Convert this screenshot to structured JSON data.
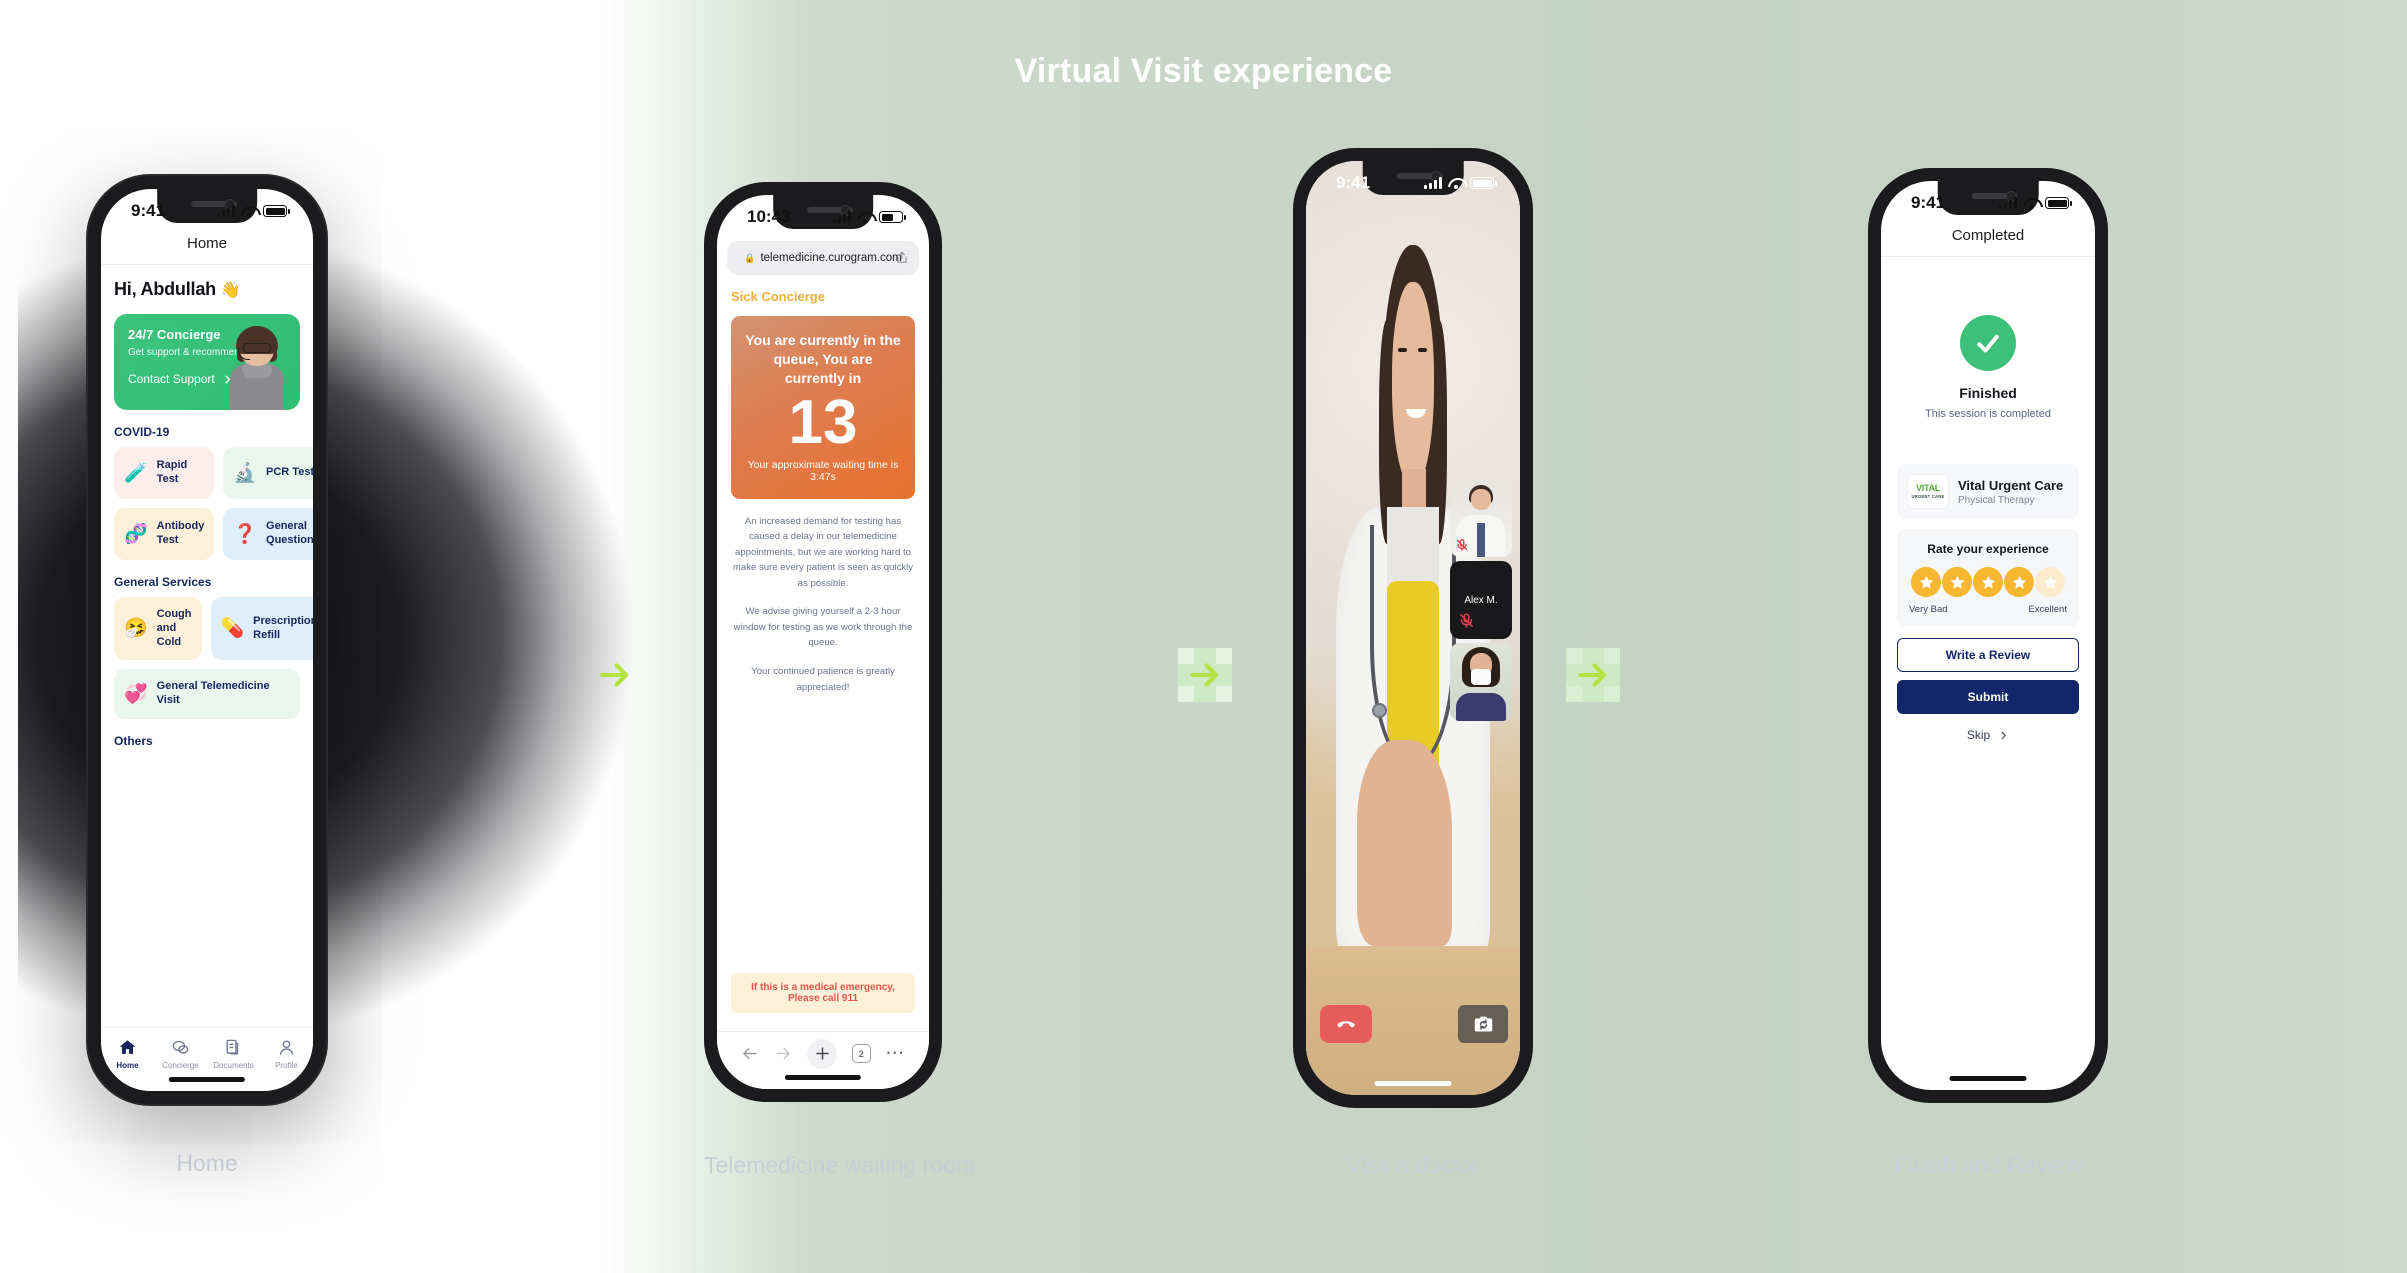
{
  "title": "Virtual Visit experience",
  "connectors": [
    {
      "icon": "arrow-right-icon"
    },
    {
      "icon": "arrow-right-icon"
    },
    {
      "icon": "arrow-right-icon"
    }
  ],
  "captions": {
    "phone1": "Home",
    "phone2": "Telemedicine waiting room",
    "phone3": "Visit a doctor",
    "phone4": "Finish and Review"
  },
  "phone1": {
    "status": {
      "time": "9:41"
    },
    "nav_title": "Home",
    "greeting": "Hi, Abdullah",
    "greeting_emoji": "👋",
    "concierge": {
      "title": "24/7 Concierge",
      "subtitle": "Get support & recommendation",
      "cta": "Contact Support"
    },
    "sections": [
      {
        "heading": "COVID-19",
        "tiles": [
          {
            "label": "Rapid Test",
            "emoji": "🧪",
            "tone": "t-pink"
          },
          {
            "label": "PCR Test",
            "emoji": "🔬",
            "tone": "t-green"
          },
          {
            "label": "Antibody Test",
            "emoji": "🧬",
            "tone": "t-amber"
          },
          {
            "label": "General Questions",
            "emoji": "❓",
            "tone": "t-blue"
          }
        ]
      },
      {
        "heading": "General Services",
        "tiles": [
          {
            "label": "Cough and Cold",
            "emoji": "🤧",
            "tone": "t-amber"
          },
          {
            "label": "Prescription Refill",
            "emoji": "💊",
            "tone": "t-blue"
          }
        ],
        "wide": {
          "label": "General Telemedicine Visit",
          "emoji": "💞",
          "tone": "t-green"
        }
      }
    ],
    "others_heading": "Others",
    "tabs": [
      {
        "label": "Home",
        "icon": "home-icon",
        "active": true
      },
      {
        "label": "Concierge",
        "icon": "chat-icon",
        "active": false
      },
      {
        "label": "Documents",
        "icon": "documents-icon",
        "active": false
      },
      {
        "label": "Profile",
        "icon": "person-icon",
        "active": false
      }
    ]
  },
  "phone2": {
    "status": {
      "time": "10:43"
    },
    "url": "telemedicine.curogram.com",
    "brand": "Sick Concierge",
    "queue": {
      "headline": "You are currently in the queue, You are currently in",
      "number": "13",
      "wait": "Your approximate waiting time is 3:47s"
    },
    "paragraphs": [
      "An increased demand for testing has caused a delay in our telemedicine appointments, but we are working hard to make sure every patient is seen as quickly as possible.",
      "We advise giving yourself a 2-3 hour window for testing as we work through the queue.",
      "Your continued patience is greatly appreciated!"
    ],
    "emergency": "If this is a medical emergency, Please call 911",
    "toolbar": {
      "back": "back-icon",
      "forward": "forward-icon",
      "new_tab": "plus-icon",
      "tab_count": "2",
      "more": "more-icon"
    }
  },
  "phone3": {
    "status": {
      "time": "9:41"
    },
    "participants": [
      {
        "name": "",
        "muted": true,
        "kind": "video"
      },
      {
        "name": "Alex M.",
        "muted": true,
        "kind": "audio-only"
      },
      {
        "name": "",
        "muted": false,
        "kind": "video"
      }
    ],
    "controls": {
      "end_call": "end-call-icon",
      "flip_camera": "flip-camera-icon"
    }
  },
  "phone4": {
    "status": {
      "time": "9:41"
    },
    "nav_title": "Completed",
    "finished_title": "Finished",
    "finished_sub": "This session is completed",
    "clinic": {
      "logo_line1": "VITAL",
      "logo_line2": "URGENT CARE",
      "name": "Vital Urgent Care",
      "specialty": "Physical Therapy"
    },
    "rating": {
      "title": "Rate your experience",
      "filled": 4,
      "total": 5,
      "low_label": "Very Bad",
      "high_label": "Excellent"
    },
    "buttons": {
      "write_review": "Write a Review",
      "submit": "Submit",
      "skip": "Skip"
    }
  }
}
